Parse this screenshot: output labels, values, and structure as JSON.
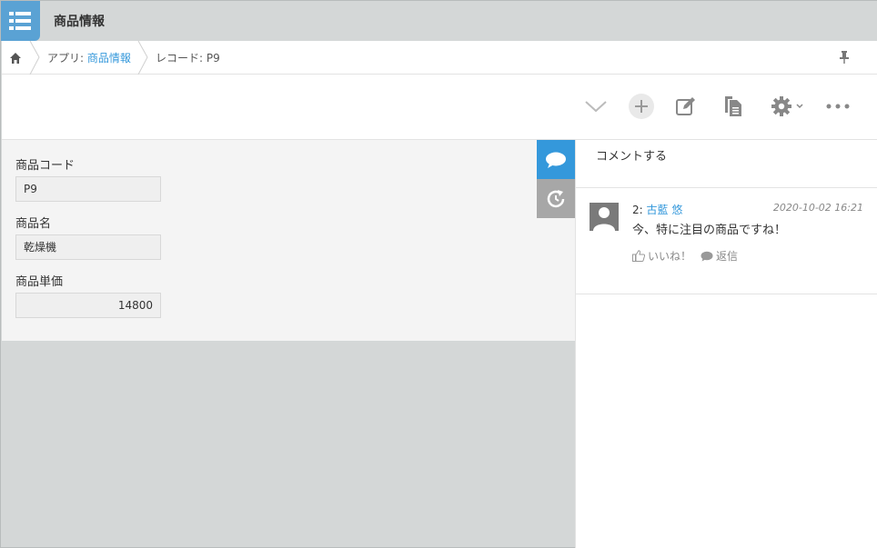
{
  "header": {
    "app_title": "商品情報",
    "accent": "#5aa2d4"
  },
  "breadcrumb": {
    "app_prefix": "アプリ: ",
    "app_name": "商品情報",
    "record": "レコード: P9"
  },
  "toolbar": {
    "icons": [
      "chevron-down-icon",
      "plus-icon",
      "edit-icon",
      "copy-icon",
      "gear-icon",
      "more-icon"
    ]
  },
  "form": {
    "fields": [
      {
        "label": "商品コード",
        "value": "P9"
      },
      {
        "label": "商品名",
        "value": "乾燥機"
      },
      {
        "label": "商品単価",
        "value": "14800"
      }
    ]
  },
  "comments": {
    "input_placeholder": "コメントする",
    "items": [
      {
        "number": "2: ",
        "user": "古藍 悠",
        "date": "2020-10-02 16:21",
        "body": "今、特に注目の商品ですね！",
        "like_label": "いいね！",
        "reply_label": "返信"
      }
    ]
  },
  "colors": {
    "active_tab": "#3498db",
    "link": "#3498db"
  }
}
